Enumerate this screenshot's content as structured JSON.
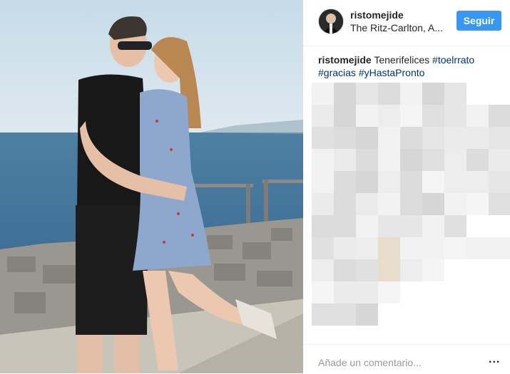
{
  "post": {
    "username": "ristomejide",
    "location": "The Ritz-Carlton, A...",
    "follow_label": "Seguir",
    "caption_text": " Tenerifelices ",
    "hashtags": [
      "#toelrrato",
      "#gracias",
      "#yHastaPronto"
    ]
  },
  "footer": {
    "comment_placeholder": "Añade un comentario...",
    "more_label": "..."
  },
  "colors": {
    "accent": "#3897f0",
    "hashtag": "#003569",
    "text": "#262626"
  },
  "icons": {
    "more": "more-options-icon"
  }
}
